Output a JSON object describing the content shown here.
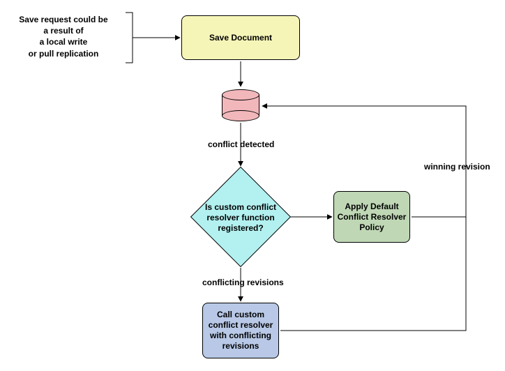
{
  "annotation": {
    "text": "Save request could be\na result of\na local write\nor pull replication"
  },
  "nodes": {
    "save_document": "Save Document",
    "decision": "Is custom conflict resolver function registered?",
    "apply_default": "Apply Default Conflict Resolver Policy",
    "call_custom": "Call custom conflict resolver with conflicting revisions"
  },
  "edges": {
    "conflict_detected": "conflict detected",
    "conflicting_revisions": "conflicting revisions",
    "winning_revision": "winning revision"
  },
  "chart_data": {
    "type": "flowchart",
    "nodes": [
      {
        "id": "annot",
        "kind": "annotation",
        "label": "Save request could be a result of a local write or pull replication"
      },
      {
        "id": "save",
        "kind": "process",
        "label": "Save Document",
        "fill": "#f5f5b8"
      },
      {
        "id": "db",
        "kind": "datastore",
        "label": "",
        "fill": "#f2b7bb"
      },
      {
        "id": "decision",
        "kind": "decision",
        "label": "Is custom conflict resolver function registered?",
        "fill": "#b3f0f0"
      },
      {
        "id": "default",
        "kind": "process",
        "label": "Apply Default Conflict Resolver Policy",
        "fill": "#bfd7b5"
      },
      {
        "id": "custom",
        "kind": "process",
        "label": "Call custom conflict resolver with conflicting revisions",
        "fill": "#b8c8e6"
      }
    ],
    "edges": [
      {
        "from": "annot",
        "to": "save",
        "label": ""
      },
      {
        "from": "save",
        "to": "db",
        "label": ""
      },
      {
        "from": "db",
        "to": "decision",
        "label": "conflict detected"
      },
      {
        "from": "decision",
        "to": "default",
        "label": ""
      },
      {
        "from": "decision",
        "to": "custom",
        "label": "conflicting revisions"
      },
      {
        "from": "default",
        "to": "db",
        "label": "winning revision",
        "kind": "feedback"
      },
      {
        "from": "custom",
        "to": "db",
        "label": "winning revision",
        "kind": "feedback"
      }
    ]
  }
}
